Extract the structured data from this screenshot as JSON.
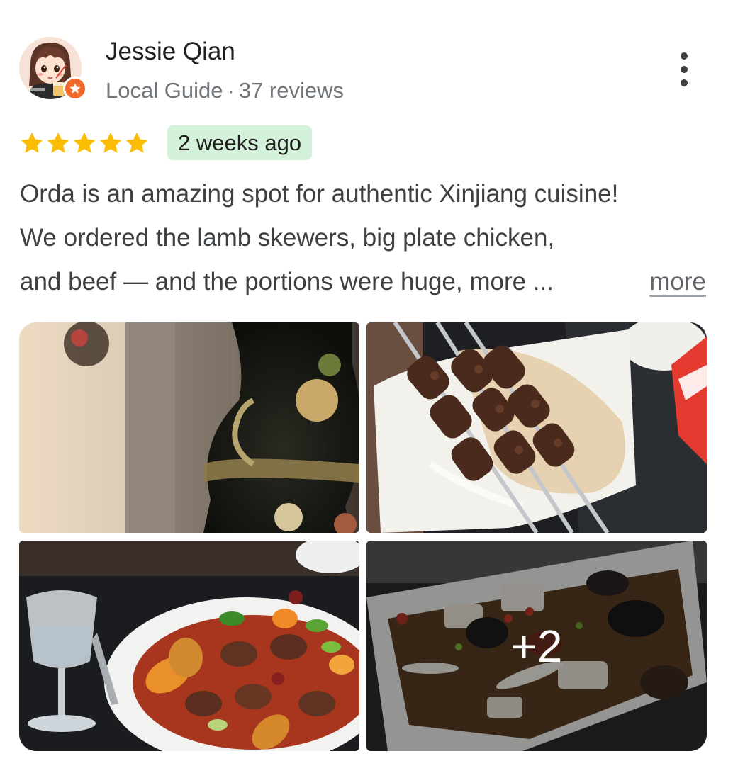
{
  "review": {
    "author": {
      "name": "Jessie Qian",
      "role": "Local Guide",
      "meta_separator": "·",
      "review_count": "37 reviews",
      "avatar_icon": "anime-girl-avatar",
      "badge_icon": "local-guide-star-icon",
      "badge_color": "#f06a2c"
    },
    "menu_icon": "more-vert-icon",
    "rating": {
      "stars": 5,
      "max": 5,
      "star_color": "#fbbc04"
    },
    "time_ago": "2 weeks ago",
    "time_badge_color": "#d4f1da",
    "text_lines": [
      "Orda is an amazing spot for authentic Xinjiang cuisine!",
      "We ordered the lamb skewers, big plate chicken,",
      "and beef — and the portions were huge, more ..."
    ],
    "more_label": "more",
    "photos": [
      {
        "subject": "decorative-vase-photo"
      },
      {
        "subject": "lamb-skewers-photo"
      },
      {
        "subject": "big-plate-chicken-photo"
      },
      {
        "subject": "beef-dish-photo",
        "overlay": "+2"
      }
    ]
  }
}
